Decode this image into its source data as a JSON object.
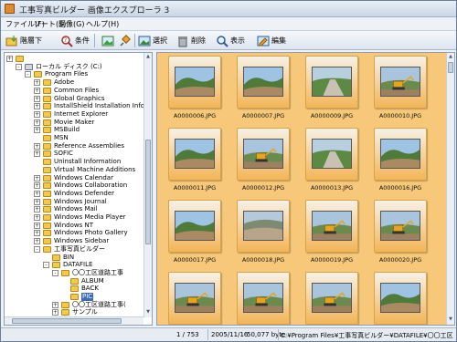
{
  "window": {
    "title": "工事写真ビルダー 画像エクスプローラ 3"
  },
  "menu": [
    {
      "label": "ファイル(F)",
      "name": "menu-file"
    },
    {
      "label": "ソート(S)",
      "name": "menu-sort"
    },
    {
      "label": "画像(G)",
      "name": "menu-image"
    },
    {
      "label": "ヘルプ(H)",
      "name": "menu-help"
    }
  ],
  "toolbar": [
    {
      "label": "階層下",
      "icon": "folder-down-icon",
      "name": "toolbar-hierarchy-down-button"
    },
    {
      "label": "条件",
      "icon": "search-icon",
      "name": "toolbar-condition-button"
    },
    {
      "label": "",
      "icon": "image-frame-icon",
      "name": "toolbar-image-frame-button"
    },
    {
      "label": "",
      "icon": "pin-icon",
      "name": "toolbar-pin-button"
    },
    {
      "label": "選択",
      "icon": "select-icon",
      "name": "toolbar-select-button"
    },
    {
      "label": "削除",
      "icon": "trash-icon",
      "name": "toolbar-delete-button"
    },
    {
      "label": "表示",
      "icon": "magnifier-icon",
      "name": "toolbar-view-button"
    },
    {
      "label": "編集",
      "icon": "edit-icon",
      "name": "toolbar-edit-button"
    }
  ],
  "tree": {
    "items": [
      {
        "label": "",
        "level": 0,
        "expander": "+",
        "name": "tree-item-top"
      },
      {
        "label": "ローカル ディスク (C:)",
        "level": 1,
        "expander": "-",
        "name": "tree-item-local-disk"
      },
      {
        "label": "Program Files",
        "level": 2,
        "expander": "-",
        "name": "tree-item-program-files"
      },
      {
        "label": "Adobe",
        "level": 3,
        "expander": "+",
        "name": "tree-item-adobe"
      },
      {
        "label": "Common Files",
        "level": 3,
        "expander": "+",
        "name": "tree-item-common-files"
      },
      {
        "label": "Global Graphics",
        "level": 3,
        "expander": "+",
        "name": "tree-item-global-graphics"
      },
      {
        "label": "InstallShield Installation Info",
        "level": 3,
        "expander": "+",
        "name": "tree-item-installshield"
      },
      {
        "label": "Internet Explorer",
        "level": 3,
        "expander": "+",
        "name": "tree-item-internet-explorer"
      },
      {
        "label": "Movie Maker",
        "level": 3,
        "expander": "+",
        "name": "tree-item-movie-maker"
      },
      {
        "label": "MSBuild",
        "level": 3,
        "expander": "+",
        "name": "tree-item-msbuild"
      },
      {
        "label": "MSN",
        "level": 3,
        "expander": "",
        "name": "tree-item-msn"
      },
      {
        "label": "Reference Assemblies",
        "level": 3,
        "expander": "+",
        "name": "tree-item-reference-assemblies"
      },
      {
        "label": "SOFIC",
        "level": 3,
        "expander": "+",
        "name": "tree-item-sofic"
      },
      {
        "label": "Uninstall Information",
        "level": 3,
        "expander": "",
        "name": "tree-item-uninstall-information"
      },
      {
        "label": "Virtual Machine Additions",
        "level": 3,
        "expander": "",
        "name": "tree-item-virtual-machine-additions"
      },
      {
        "label": "Windows Calendar",
        "level": 3,
        "expander": "+",
        "name": "tree-item-windows-calendar"
      },
      {
        "label": "Windows Collaboration",
        "level": 3,
        "expander": "+",
        "name": "tree-item-windows-collaboration"
      },
      {
        "label": "Windows Defender",
        "level": 3,
        "expander": "+",
        "name": "tree-item-windows-defender"
      },
      {
        "label": "Windows Journal",
        "level": 3,
        "expander": "+",
        "name": "tree-item-windows-journal"
      },
      {
        "label": "Windows Mail",
        "level": 3,
        "expander": "+",
        "name": "tree-item-windows-mail"
      },
      {
        "label": "Windows Media Player",
        "level": 3,
        "expander": "+",
        "name": "tree-item-windows-media-player"
      },
      {
        "label": "Windows NT",
        "level": 3,
        "expander": "+",
        "name": "tree-item-windows-nt"
      },
      {
        "label": "Windows Photo Gallery",
        "level": 3,
        "expander": "+",
        "name": "tree-item-windows-photo-gallery"
      },
      {
        "label": "Windows Sidebar",
        "level": 3,
        "expander": "+",
        "name": "tree-item-windows-sidebar"
      },
      {
        "label": "工事写真ビルダー",
        "level": 3,
        "expander": "-",
        "name": "tree-item-koji-shashin-builder"
      },
      {
        "label": "BIN",
        "level": 4,
        "expander": "",
        "name": "tree-item-bin"
      },
      {
        "label": "DATAFILE",
        "level": 4,
        "expander": "-",
        "name": "tree-item-datafile"
      },
      {
        "label": "〇〇工区道路工事",
        "level": 5,
        "expander": "-",
        "name": "tree-item-road-work-1"
      },
      {
        "label": "ALBUM",
        "level": 6,
        "expander": "",
        "name": "tree-item-album"
      },
      {
        "label": "BACK",
        "level": 6,
        "expander": "",
        "name": "tree-item-back"
      },
      {
        "label": "PIC",
        "level": 6,
        "expander": "",
        "name": "tree-item-pic",
        "selected": true
      },
      {
        "label": "〇〇工区道路工事(",
        "level": 5,
        "expander": "+",
        "name": "tree-item-road-work-2"
      },
      {
        "label": "サンプル",
        "level": 5,
        "expander": "+",
        "name": "tree-item-sample"
      }
    ]
  },
  "thumbnails": [
    {
      "filename": "A0000006.JPG",
      "scene": "hill"
    },
    {
      "filename": "A0000007.JPG",
      "scene": "hill"
    },
    {
      "filename": "A0000009.JPG",
      "scene": "road"
    },
    {
      "filename": "A0000010.JPG",
      "scene": "machine"
    },
    {
      "filename": "A0000011.JPG",
      "scene": "hill"
    },
    {
      "filename": "A0000012.JPG",
      "scene": "machine"
    },
    {
      "filename": "A0000013.JPG",
      "scene": "road"
    },
    {
      "filename": "A0000016.JPG",
      "scene": "hill"
    },
    {
      "filename": "A0000017.JPG",
      "scene": "hill"
    },
    {
      "filename": "A0000018.JPG",
      "scene": "rock"
    },
    {
      "filename": "A0000019.JPG",
      "scene": "machine"
    },
    {
      "filename": "A0000020.JPG",
      "scene": "machine"
    },
    {
      "filename": "",
      "scene": "machine"
    },
    {
      "filename": "",
      "scene": "machine"
    },
    {
      "filename": "",
      "scene": "machine"
    },
    {
      "filename": "",
      "scene": "hill"
    }
  ],
  "status": {
    "count": "1 / 753",
    "date": "2005/11/16",
    "size": "50,077 byte",
    "path": "C:¥Program Files¥工事写真ビルダー¥DATAFILE¥〇〇工区"
  },
  "colors": {
    "thumb_bg": "#f7c879",
    "selection": "#3d6cb8"
  }
}
